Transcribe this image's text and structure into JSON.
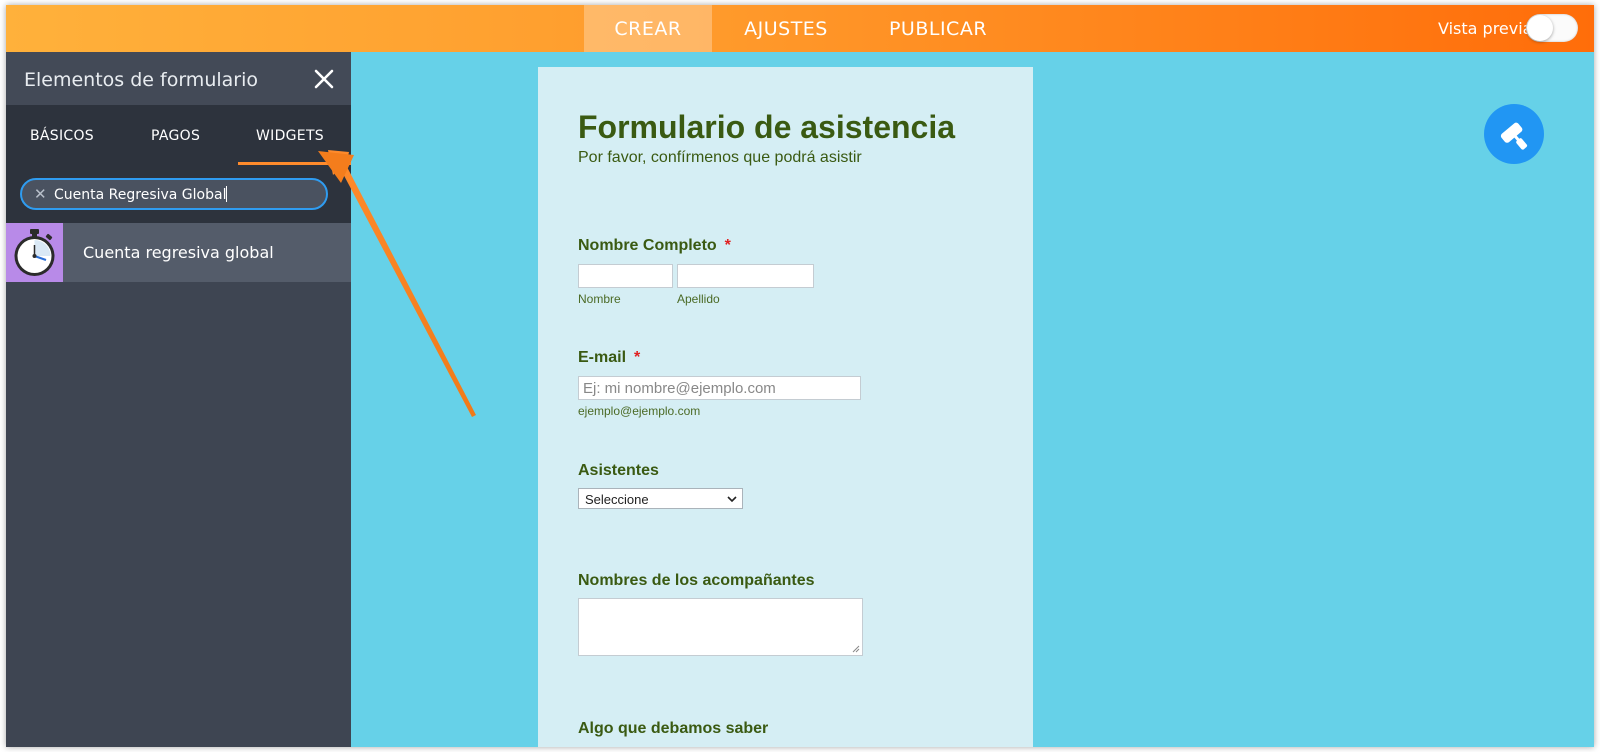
{
  "topbar": {
    "tabs": [
      {
        "label": "CREAR",
        "active": true
      },
      {
        "label": "AJUSTES",
        "active": false
      },
      {
        "label": "PUBLICAR",
        "active": false
      }
    ],
    "preview_label": "Vista previa",
    "preview_enabled": false
  },
  "sidebar": {
    "title": "Elementos de formulario",
    "close_icon": "close-icon",
    "tabs": [
      {
        "label": "BÁSICOS",
        "active": false
      },
      {
        "label": "PAGOS",
        "active": false
      },
      {
        "label": "WIDGETS",
        "active": true
      }
    ],
    "search": {
      "value": "Cuenta Regresiva Global"
    },
    "results": [
      {
        "label": "Cuenta regresiva global",
        "icon": "stopwatch-icon"
      }
    ]
  },
  "form": {
    "title": "Formulario de asistencia",
    "subtitle": "Por favor, confírmenos que podrá asistir",
    "fields": {
      "name": {
        "label": "Nombre Completo",
        "required_mark": "*",
        "first_sub": "Nombre",
        "last_sub": "Apellido"
      },
      "email": {
        "label": "E-mail",
        "required_mark": "*",
        "placeholder": "Ej: mi nombre@ejemplo.com",
        "sublabel": "ejemplo@ejemplo.com"
      },
      "attendees": {
        "label": "Asistentes",
        "selected": "Seleccione"
      },
      "companions": {
        "label": "Nombres de los acompañantes"
      },
      "notes": {
        "label": "Algo que debamos saber"
      }
    }
  },
  "paint_button": {
    "icon": "paint-roller-icon"
  },
  "colors": {
    "accent_orange": "#ff8b2c",
    "sidebar_bg": "#3e4552",
    "canvas_bg": "#66d1e8",
    "form_bg": "#d5eef4",
    "form_text": "#3a5a12",
    "paint_button": "#2196f3"
  }
}
